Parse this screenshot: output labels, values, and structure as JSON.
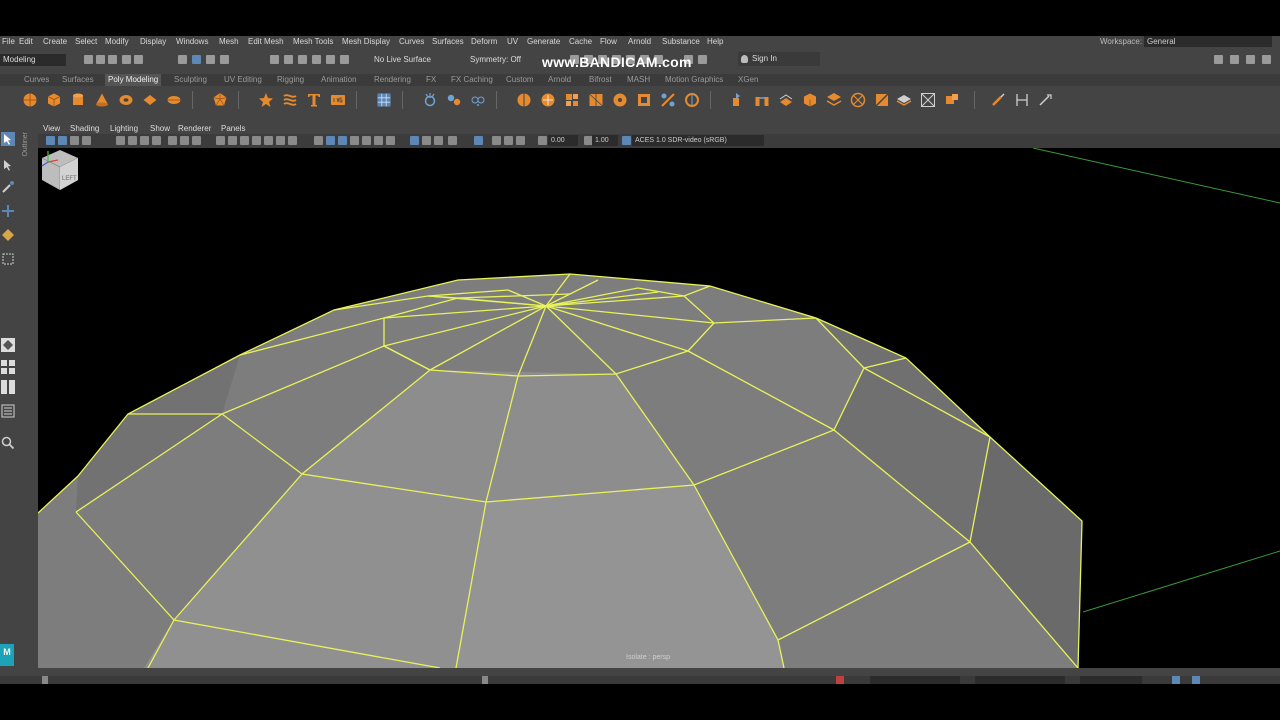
{
  "menu": [
    "File",
    "Edit",
    "Create",
    "Select",
    "Modify",
    "Display",
    "Windows",
    "Mesh",
    "Edit Mesh",
    "Mesh Tools",
    "Mesh Display",
    "Curves",
    "Surfaces",
    "Deform",
    "UV",
    "Generate",
    "Cache",
    "Flow",
    "Arnold",
    "Substance",
    "Help"
  ],
  "workspace": {
    "label": "Workspace:",
    "value": "General"
  },
  "status_line": {
    "mode": "Modeling",
    "live_surface": "No Live Surface",
    "symmetry": "Symmetry: Off",
    "sign_in": "Sign In"
  },
  "watermark": "www.BANDICAM.com",
  "shelf_tabs": [
    "Curves",
    "Surfaces",
    "Poly Modeling",
    "Sculpting",
    "UV Editing",
    "Rigging",
    "Animation",
    "Rendering",
    "FX",
    "FX Caching",
    "Custom",
    "Arnold",
    "Bifrost",
    "MASH",
    "Motion Graphics",
    "XGen"
  ],
  "active_shelf_tab": "Poly Modeling",
  "outliner_tab": "Outliner",
  "panel_menu": [
    "View",
    "Shading",
    "Lighting",
    "Show",
    "Renderer",
    "Panels"
  ],
  "panel_toolbar": {
    "exposure": "0.00",
    "gamma": "1.00",
    "color_space": "ACES 1.0 SDR-video (sRGB)"
  },
  "viewport": {
    "label": "Isolate : persp",
    "viewcube_face": "LEFT"
  },
  "logo": "M",
  "colors": {
    "wireframe": "#e8f25a",
    "mesh_fill": "#8c8c8c",
    "grid_line": "#3a9a3a",
    "ui_bg": "#444444"
  }
}
